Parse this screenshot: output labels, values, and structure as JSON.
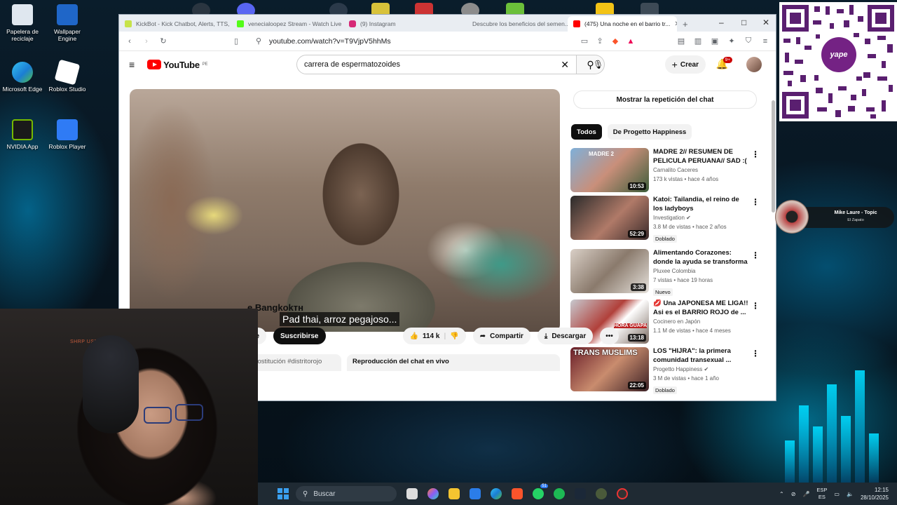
{
  "desktop": {
    "icons": [
      {
        "label": "Papelera de reciclaje"
      },
      {
        "label": "Wallpaper Engine"
      },
      {
        "label": "Microsoft Edge"
      },
      {
        "label": "Roblox Studio"
      },
      {
        "label": "NVIDIA App"
      },
      {
        "label": "Roblox Player"
      }
    ]
  },
  "browser": {
    "tabs": [
      {
        "label": "KickBot - Kick Chatbot, Alerts, TTS, ...",
        "color": "#c7e34a"
      },
      {
        "label": "venecialoopez Stream - Watch Live",
        "color": "#53fc18"
      },
      {
        "label": "(9) Instagram",
        "color": "#d62976"
      },
      {
        "label": "Descubre los beneficios del semen...",
        "color": "#9e9e9e"
      },
      {
        "label": "(475) Una noche en el barrio tr...",
        "color": "#ff0000"
      }
    ],
    "new_tab": "+",
    "window_controls": {
      "minimize": "–",
      "maximize": "□",
      "close": "✕"
    },
    "url": "youtube.com/watch?v=T9VjpV5hhMs"
  },
  "youtube": {
    "logo_text": "YouTube",
    "logo_region": "PE",
    "search_value": "carrera de espermatozoides",
    "create_label": "Crear",
    "notifications_badge": "9+",
    "player": {
      "subtitle": "Pad thai, arroz pegajoso..."
    },
    "video_title": "e Bangkokтн",
    "subscribe_partial": "rse",
    "subscribe_label": "Suscribirse",
    "likes": "114 k",
    "share_label": "Compartir",
    "download_label": "Descargar",
    "more_label": "•••",
    "description_tags": "prostitución #distritorojo",
    "chat_replay_label": "Reproducción del chat en vivo",
    "chat_button": "Mostrar la repetición del chat",
    "chips": [
      "Todos",
      "De Progetto Happiness"
    ],
    "recommendations": [
      {
        "title": "MADRE 2// RESUMEN DE PELICULA PERUANA// SAD :(",
        "channel": "Carnalito Caceres",
        "meta": "173 k vistas • hace 4 años",
        "duration": "10:53",
        "badge": "",
        "thumb_text": "MADRE 2"
      },
      {
        "title": "Katoi: Tailandia, el reino de los ladyboys",
        "channel": "Investigation ✔",
        "meta": "3.8 M de vistas • hace 2 años",
        "duration": "52:29",
        "badge": "Doblado",
        "thumb_text": ""
      },
      {
        "title": "Alimentando Corazones: donde la ayuda se transforma en ...",
        "channel": "Pluxee Colombia",
        "meta": "7 vistas • hace 19 horas",
        "duration": "3:38",
        "badge": "Nuevo",
        "thumb_text": ""
      },
      {
        "title": "💋 Una JAPONESA ME LIGA!! Asi es el BARRIO ROJO de ...",
        "channel": "Cocinero en Japón",
        "meta": "1.1 M de vistas • hace 4 meses",
        "duration": "13:18",
        "badge": "",
        "thumb_text": "HORA GUAPA"
      },
      {
        "title": "LOS \"HIJRA\": la primera comunidad transexual ...",
        "channel": "Progetto Happiness ✔",
        "meta": "3 M de vistas • hace 1 año",
        "duration": "22:05",
        "badge": "Doblado",
        "thumb_text": "TRANS MUSLIMS"
      }
    ]
  },
  "webcam": {
    "label": "SHRP USER"
  },
  "qr": {
    "brand": "yape"
  },
  "music_widget": {
    "song": "Mike Laure - Topic",
    "artist": "El Zapato"
  },
  "taskbar": {
    "search_placeholder": "Buscar",
    "lang_top": "ESP",
    "lang_bottom": "ES",
    "time": "12:15",
    "date": "28/10/2025",
    "steam_badge": "51"
  },
  "colors": {
    "youtube_red": "#ff0000",
    "taskbar": "#1f2a33",
    "yape_purple": "#742284"
  }
}
